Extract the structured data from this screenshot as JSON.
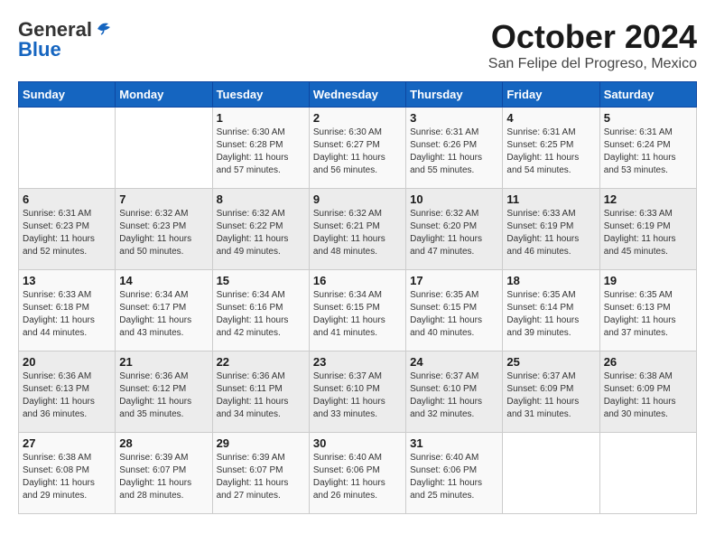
{
  "logo": {
    "line1": "General",
    "line2": "Blue"
  },
  "title": "October 2024",
  "location": "San Felipe del Progreso, Mexico",
  "days_header": [
    "Sunday",
    "Monday",
    "Tuesday",
    "Wednesday",
    "Thursday",
    "Friday",
    "Saturday"
  ],
  "weeks": [
    [
      {
        "day": "",
        "info": ""
      },
      {
        "day": "",
        "info": ""
      },
      {
        "day": "1",
        "info": "Sunrise: 6:30 AM\nSunset: 6:28 PM\nDaylight: 11 hours\nand 57 minutes."
      },
      {
        "day": "2",
        "info": "Sunrise: 6:30 AM\nSunset: 6:27 PM\nDaylight: 11 hours\nand 56 minutes."
      },
      {
        "day": "3",
        "info": "Sunrise: 6:31 AM\nSunset: 6:26 PM\nDaylight: 11 hours\nand 55 minutes."
      },
      {
        "day": "4",
        "info": "Sunrise: 6:31 AM\nSunset: 6:25 PM\nDaylight: 11 hours\nand 54 minutes."
      },
      {
        "day": "5",
        "info": "Sunrise: 6:31 AM\nSunset: 6:24 PM\nDaylight: 11 hours\nand 53 minutes."
      }
    ],
    [
      {
        "day": "6",
        "info": "Sunrise: 6:31 AM\nSunset: 6:23 PM\nDaylight: 11 hours\nand 52 minutes."
      },
      {
        "day": "7",
        "info": "Sunrise: 6:32 AM\nSunset: 6:23 PM\nDaylight: 11 hours\nand 50 minutes."
      },
      {
        "day": "8",
        "info": "Sunrise: 6:32 AM\nSunset: 6:22 PM\nDaylight: 11 hours\nand 49 minutes."
      },
      {
        "day": "9",
        "info": "Sunrise: 6:32 AM\nSunset: 6:21 PM\nDaylight: 11 hours\nand 48 minutes."
      },
      {
        "day": "10",
        "info": "Sunrise: 6:32 AM\nSunset: 6:20 PM\nDaylight: 11 hours\nand 47 minutes."
      },
      {
        "day": "11",
        "info": "Sunrise: 6:33 AM\nSunset: 6:19 PM\nDaylight: 11 hours\nand 46 minutes."
      },
      {
        "day": "12",
        "info": "Sunrise: 6:33 AM\nSunset: 6:19 PM\nDaylight: 11 hours\nand 45 minutes."
      }
    ],
    [
      {
        "day": "13",
        "info": "Sunrise: 6:33 AM\nSunset: 6:18 PM\nDaylight: 11 hours\nand 44 minutes."
      },
      {
        "day": "14",
        "info": "Sunrise: 6:34 AM\nSunset: 6:17 PM\nDaylight: 11 hours\nand 43 minutes."
      },
      {
        "day": "15",
        "info": "Sunrise: 6:34 AM\nSunset: 6:16 PM\nDaylight: 11 hours\nand 42 minutes."
      },
      {
        "day": "16",
        "info": "Sunrise: 6:34 AM\nSunset: 6:15 PM\nDaylight: 11 hours\nand 41 minutes."
      },
      {
        "day": "17",
        "info": "Sunrise: 6:35 AM\nSunset: 6:15 PM\nDaylight: 11 hours\nand 40 minutes."
      },
      {
        "day": "18",
        "info": "Sunrise: 6:35 AM\nSunset: 6:14 PM\nDaylight: 11 hours\nand 39 minutes."
      },
      {
        "day": "19",
        "info": "Sunrise: 6:35 AM\nSunset: 6:13 PM\nDaylight: 11 hours\nand 37 minutes."
      }
    ],
    [
      {
        "day": "20",
        "info": "Sunrise: 6:36 AM\nSunset: 6:13 PM\nDaylight: 11 hours\nand 36 minutes."
      },
      {
        "day": "21",
        "info": "Sunrise: 6:36 AM\nSunset: 6:12 PM\nDaylight: 11 hours\nand 35 minutes."
      },
      {
        "day": "22",
        "info": "Sunrise: 6:36 AM\nSunset: 6:11 PM\nDaylight: 11 hours\nand 34 minutes."
      },
      {
        "day": "23",
        "info": "Sunrise: 6:37 AM\nSunset: 6:10 PM\nDaylight: 11 hours\nand 33 minutes."
      },
      {
        "day": "24",
        "info": "Sunrise: 6:37 AM\nSunset: 6:10 PM\nDaylight: 11 hours\nand 32 minutes."
      },
      {
        "day": "25",
        "info": "Sunrise: 6:37 AM\nSunset: 6:09 PM\nDaylight: 11 hours\nand 31 minutes."
      },
      {
        "day": "26",
        "info": "Sunrise: 6:38 AM\nSunset: 6:09 PM\nDaylight: 11 hours\nand 30 minutes."
      }
    ],
    [
      {
        "day": "27",
        "info": "Sunrise: 6:38 AM\nSunset: 6:08 PM\nDaylight: 11 hours\nand 29 minutes."
      },
      {
        "day": "28",
        "info": "Sunrise: 6:39 AM\nSunset: 6:07 PM\nDaylight: 11 hours\nand 28 minutes."
      },
      {
        "day": "29",
        "info": "Sunrise: 6:39 AM\nSunset: 6:07 PM\nDaylight: 11 hours\nand 27 minutes."
      },
      {
        "day": "30",
        "info": "Sunrise: 6:40 AM\nSunset: 6:06 PM\nDaylight: 11 hours\nand 26 minutes."
      },
      {
        "day": "31",
        "info": "Sunrise: 6:40 AM\nSunset: 6:06 PM\nDaylight: 11 hours\nand 25 minutes."
      },
      {
        "day": "",
        "info": ""
      },
      {
        "day": "",
        "info": ""
      }
    ]
  ]
}
